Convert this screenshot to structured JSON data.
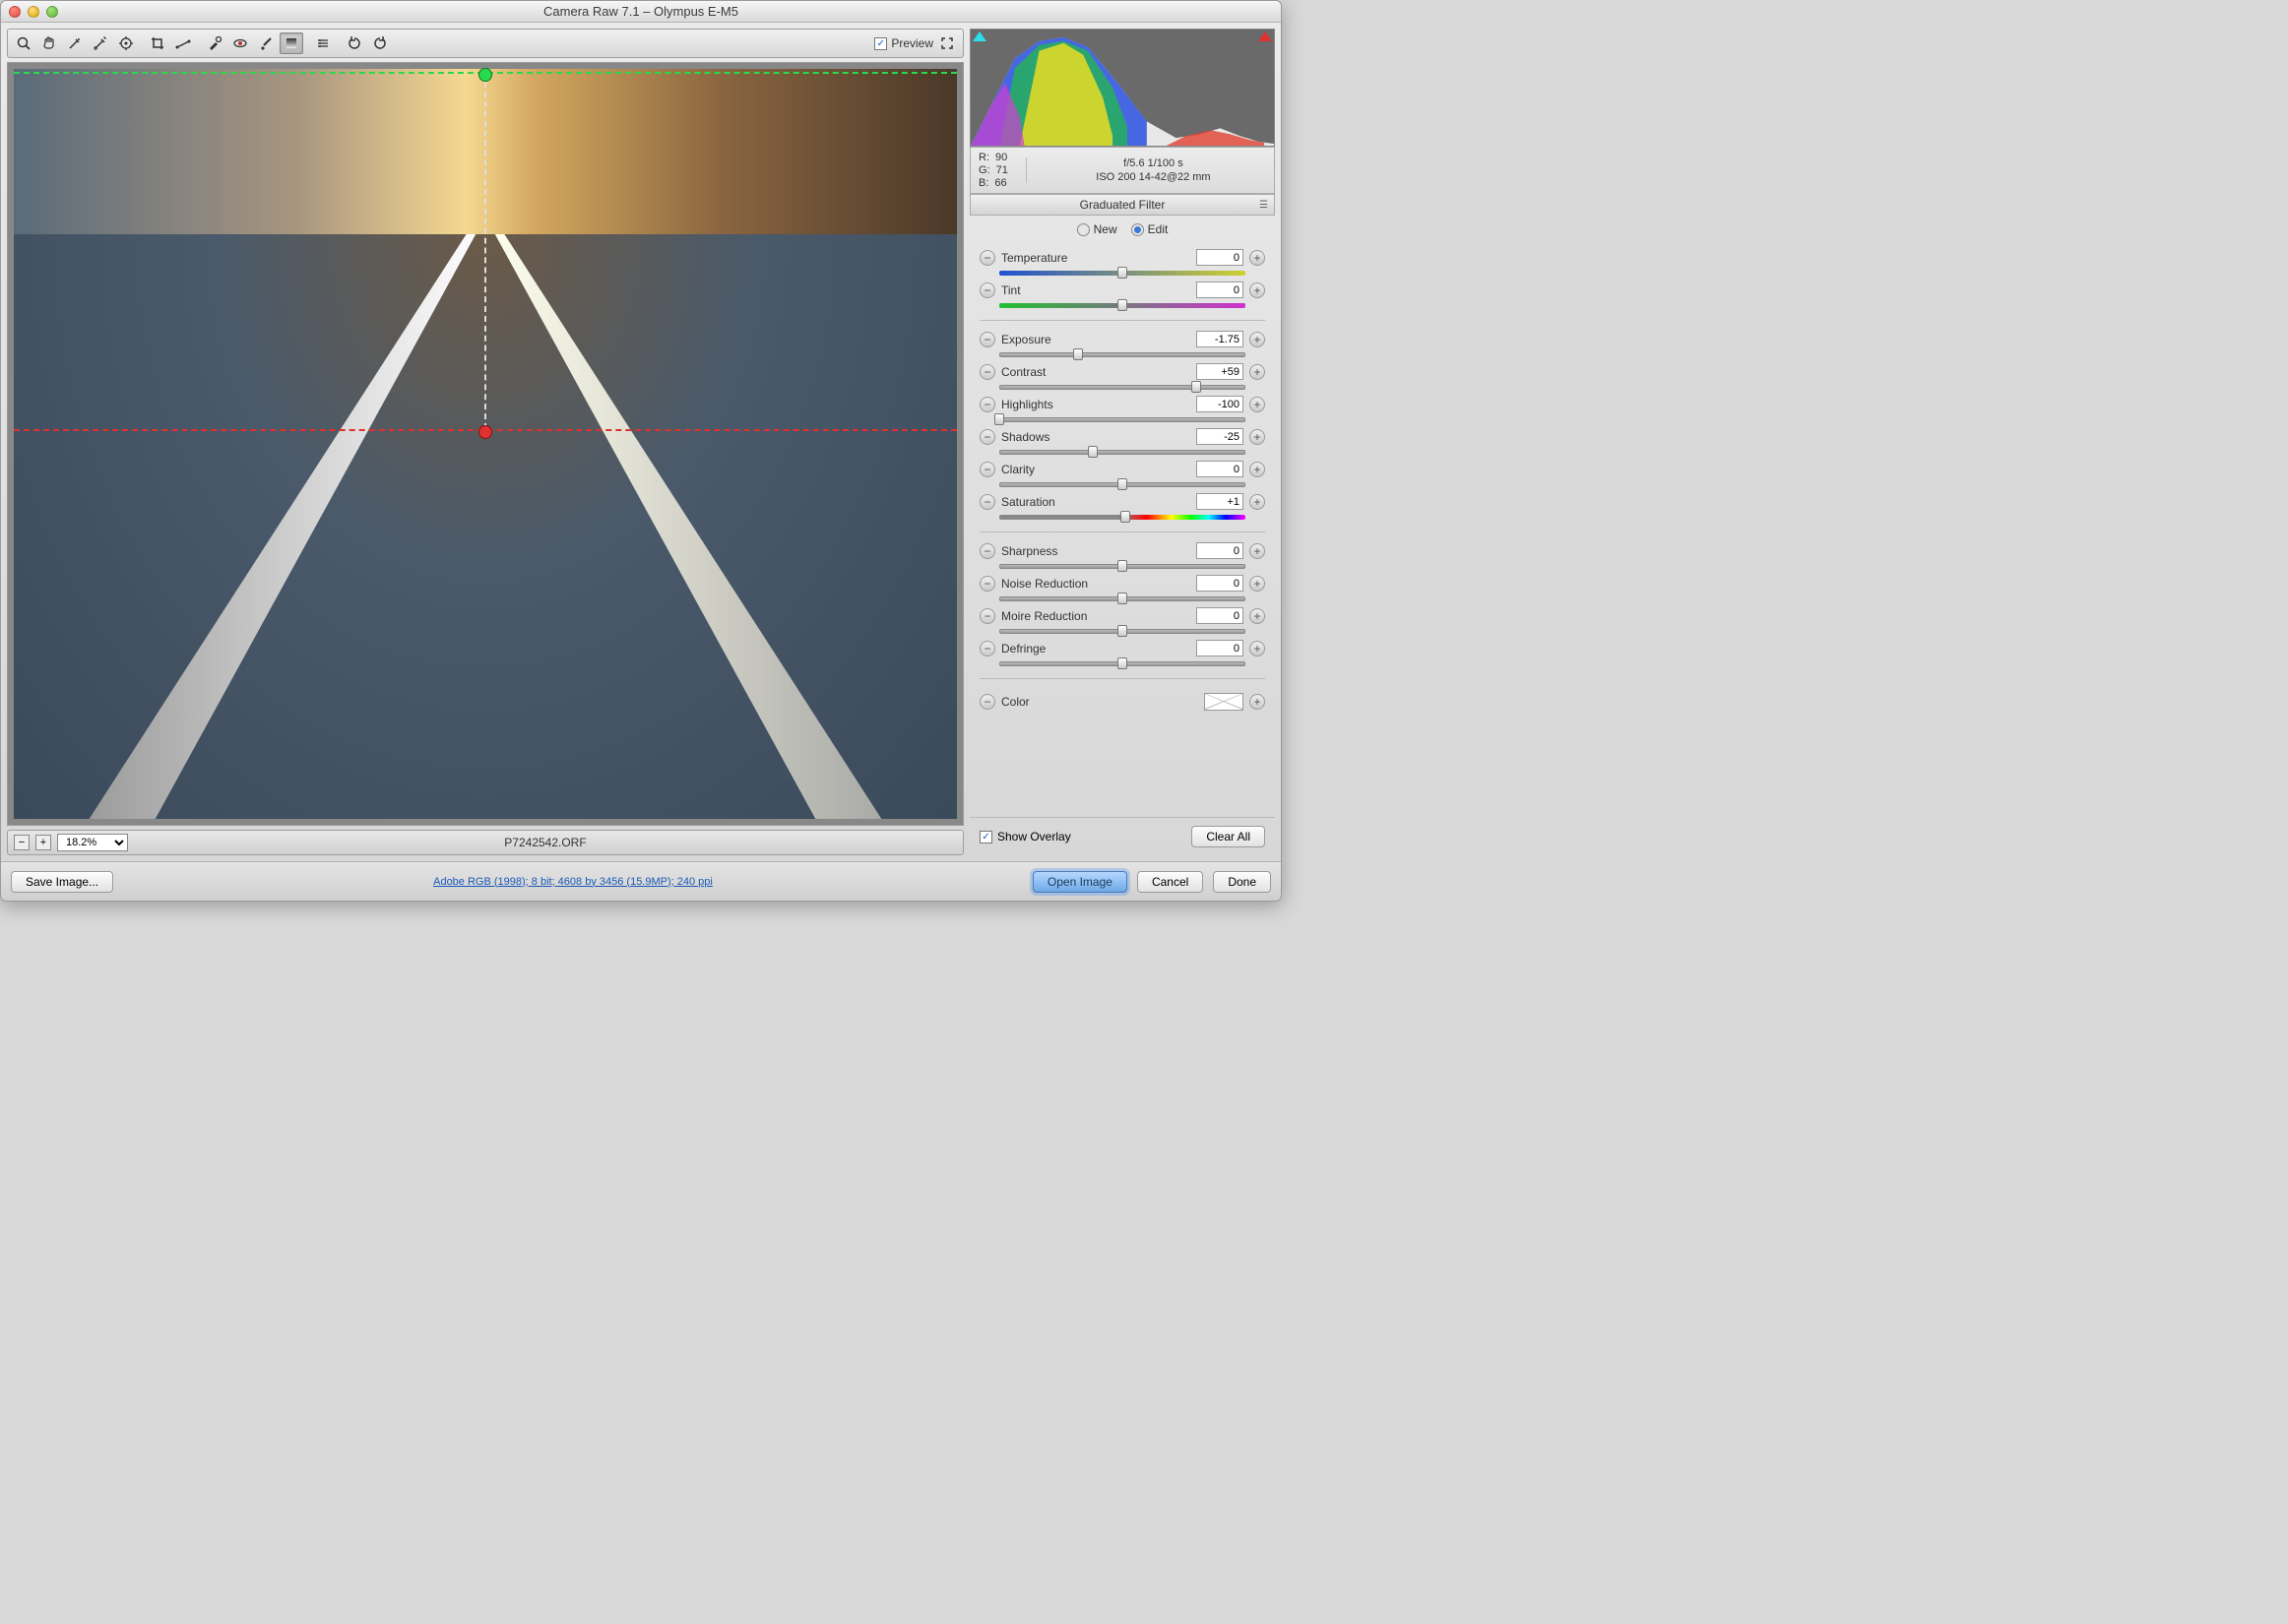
{
  "title": "Camera Raw 7.1  –  Olympus E-M5",
  "preview_label": "Preview",
  "preview_checked": true,
  "zoom": "18.2%",
  "filename": "P7242542.ORF",
  "save_btn": "Save Image...",
  "profile_link": "Adobe RGB (1998); 8 bit; 4608 by 3456 (15.9MP); 240 ppi",
  "open_btn": "Open Image",
  "cancel_btn": "Cancel",
  "done_btn": "Done",
  "rgb": {
    "r_label": "R:",
    "r": "90",
    "g_label": "G:",
    "g": "71",
    "b_label": "B:",
    "b": "66"
  },
  "exif": {
    "line1": "f/5.6   1/100 s",
    "line2": "ISO 200   14-42@22 mm"
  },
  "panel_title": "Graduated Filter",
  "mode": {
    "new": "New",
    "edit": "Edit",
    "selected": "edit"
  },
  "sliders": {
    "temperature": {
      "label": "Temperature",
      "value": "0",
      "pos": 50,
      "track": "temp"
    },
    "tint": {
      "label": "Tint",
      "value": "0",
      "pos": 50,
      "track": "tint"
    },
    "exposure": {
      "label": "Exposure",
      "value": "-1.75",
      "pos": 32,
      "track": "grey"
    },
    "contrast": {
      "label": "Contrast",
      "value": "+59",
      "pos": 80,
      "track": "grey"
    },
    "highlights": {
      "label": "Highlights",
      "value": "-100",
      "pos": 0,
      "track": "grey"
    },
    "shadows": {
      "label": "Shadows",
      "value": "-25",
      "pos": 38,
      "track": "grey"
    },
    "clarity": {
      "label": "Clarity",
      "value": "0",
      "pos": 50,
      "track": "grey"
    },
    "saturation": {
      "label": "Saturation",
      "value": "+1",
      "pos": 51,
      "track": "sat"
    },
    "sharpness": {
      "label": "Sharpness",
      "value": "0",
      "pos": 50,
      "track": "grey"
    },
    "noise": {
      "label": "Noise Reduction",
      "value": "0",
      "pos": 50,
      "track": "grey"
    },
    "moire": {
      "label": "Moire Reduction",
      "value": "0",
      "pos": 50,
      "track": "grey"
    },
    "defringe": {
      "label": "Defringe",
      "value": "0",
      "pos": 50,
      "track": "grey"
    }
  },
  "color_label": "Color",
  "overlay_label": "Show Overlay",
  "overlay_checked": true,
  "clear_btn": "Clear All"
}
